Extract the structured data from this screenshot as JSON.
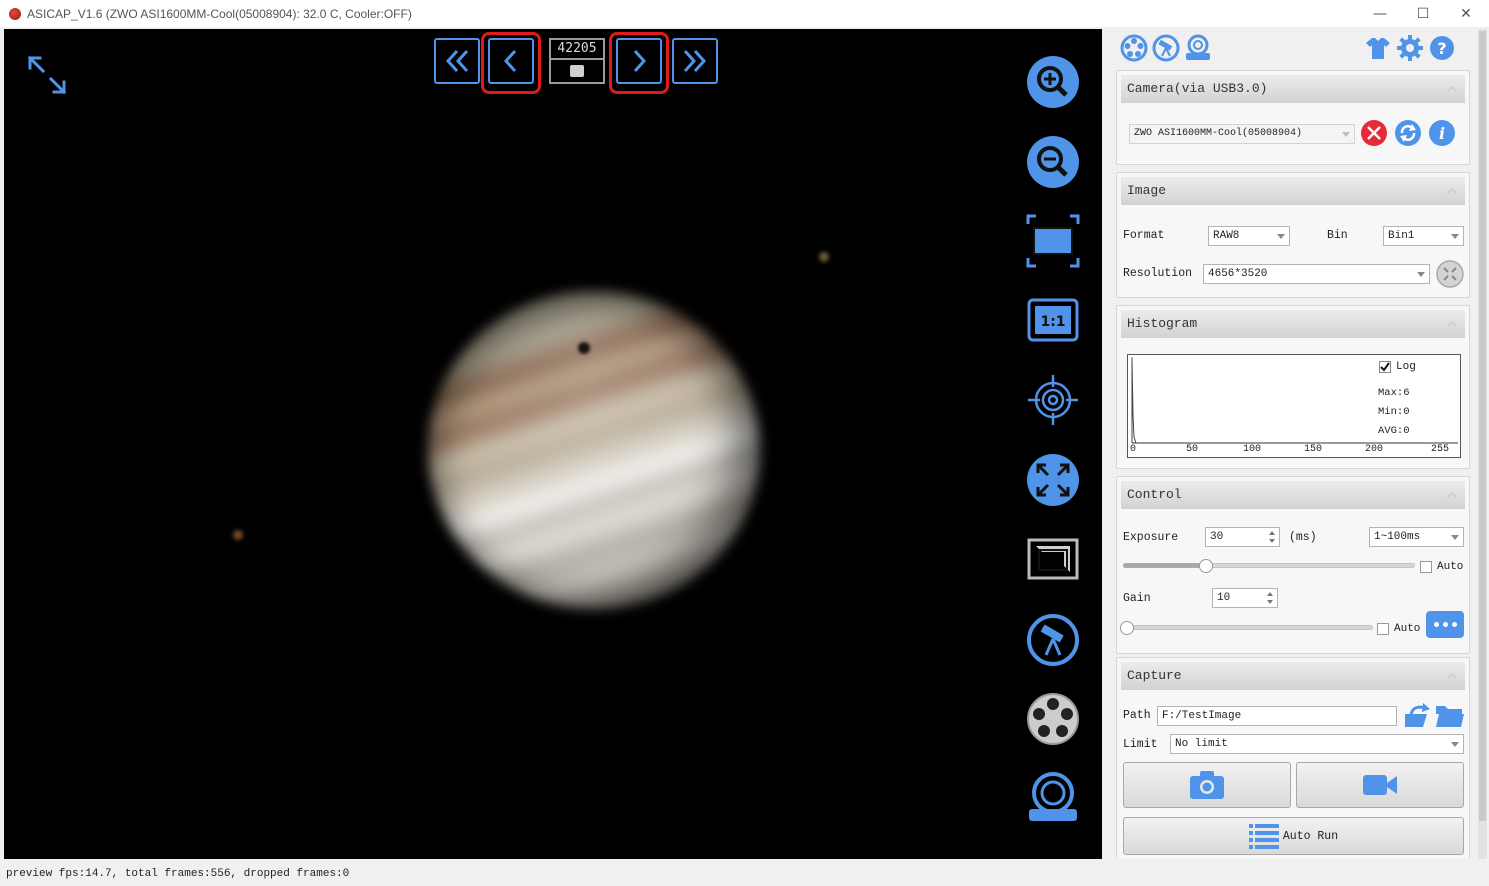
{
  "titlebar": {
    "title": "ASICAP_V1.6 (ZWO ASI1600MM-Cool(05008904): 32.0 C, Cooler:OFF)",
    "minimize": "—",
    "maximize": "☐",
    "close": "✕"
  },
  "player": {
    "frame_counter": "42205"
  },
  "camera": {
    "header": "Camera(via USB3.0)",
    "selected": "ZWO ASI1600MM-Cool(05008904)"
  },
  "image": {
    "header": "Image",
    "format_label": "Format",
    "format_value": "RAW8",
    "bin_label": "Bin",
    "bin_value": "Bin1",
    "resolution_label": "Resolution",
    "resolution_value": "4656*3520"
  },
  "histogram": {
    "header": "Histogram",
    "log_label": "Log",
    "log_checked": true,
    "max": "Max:6",
    "min": "Min:0",
    "avg": "AVG:0",
    "x_ticks": [
      "0",
      "50",
      "100",
      "150",
      "200",
      "255"
    ]
  },
  "control": {
    "header": "Control",
    "exposure_label": "Exposure",
    "exposure_value": "30",
    "exposure_unit": "(ms)",
    "exposure_range": "1~100ms",
    "exposure_auto_label": "Auto",
    "exposure_slider_level": 0.27,
    "gain_label": "Gain",
    "gain_value": "10",
    "gain_auto_label": "Auto",
    "gain_slider_level": 0.0
  },
  "capture": {
    "header": "Capture",
    "path_label": "Path",
    "path_value": "F:/TestImage",
    "limit_label": "Limit",
    "limit_value": "No limit",
    "auto_run_label": "Auto Run"
  },
  "status": {
    "text": "preview fps:14.7, total frames:556, dropped frames:0"
  },
  "colors": {
    "accent_blue": "#4f94e8",
    "highlight_red": "#e01b1b",
    "disconnect_red": "#e52b3a"
  }
}
